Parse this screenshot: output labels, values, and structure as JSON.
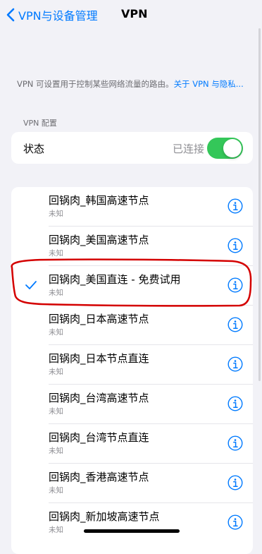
{
  "navbar": {
    "back_label": "VPN与设备管理",
    "title": "VPN"
  },
  "description": {
    "text": "VPN 可设置用于控制某些网络流量的路由。",
    "link": "关于 VPN 与隐私..."
  },
  "vpn_config": {
    "section_header": "VPN 配置",
    "status_label": "状态",
    "status_value": "已连接",
    "toggle_on": true
  },
  "vpn_list": [
    {
      "name": "回锅肉_韩国高速节点",
      "status": "未知",
      "selected": false
    },
    {
      "name": "回锅肉_美国高速节点",
      "status": "未知",
      "selected": false
    },
    {
      "name": "回锅肉_美国直连 - 免费试用",
      "status": "未知",
      "selected": true
    },
    {
      "name": "回锅肉_日本高速节点",
      "status": "未知",
      "selected": false
    },
    {
      "name": "回锅肉_日本节点直连",
      "status": "未知",
      "selected": false
    },
    {
      "name": "回锅肉_台湾高速节点",
      "status": "未知",
      "selected": false
    },
    {
      "name": "回锅肉_台湾节点直连",
      "status": "未知",
      "selected": false
    },
    {
      "name": "回锅肉_香港高速节点",
      "status": "未知",
      "selected": false
    },
    {
      "name": "回锅肉_新加坡高速节点",
      "status": "未知",
      "selected": false
    }
  ],
  "colors": {
    "accent": "#007aff",
    "toggle_on": "#34c759",
    "annotation": "#d40000",
    "background": "#f2f2f7"
  },
  "icons": {
    "back": "chevron-left-icon",
    "info": "info-circle-icon",
    "check": "checkmark-icon"
  }
}
